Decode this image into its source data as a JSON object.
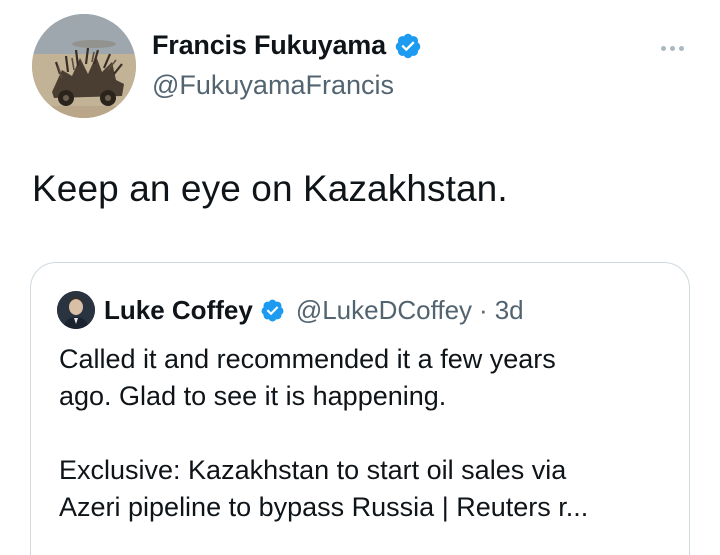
{
  "tweet": {
    "author_name": "Francis Fukuyama",
    "author_handle": "@FukuyamaFrancis",
    "text": "Keep an eye on Kazakhstan.",
    "avatar_icon": "desert-vehicle-avatar",
    "verified_icon": "verified-badge-icon",
    "more_icon": "more-options-icon"
  },
  "quote": {
    "author_name": "Luke Coffey",
    "author_handle": "@LukeDCoffey",
    "separator": "·",
    "time": "3d",
    "text_line_1": "Called it and recommended it a few years",
    "text_line_2": "ago. Glad to see it is happening.",
    "link_line_1": "Exclusive: Kazakhstan to start oil sales via",
    "link_line_2": "Azeri pipeline to bypass Russia | Reuters r..."
  },
  "colors": {
    "text_primary": "#0f1419",
    "text_secondary": "#536471",
    "verified_blue": "#1d9bf0",
    "card_border": "#cfd9de"
  }
}
